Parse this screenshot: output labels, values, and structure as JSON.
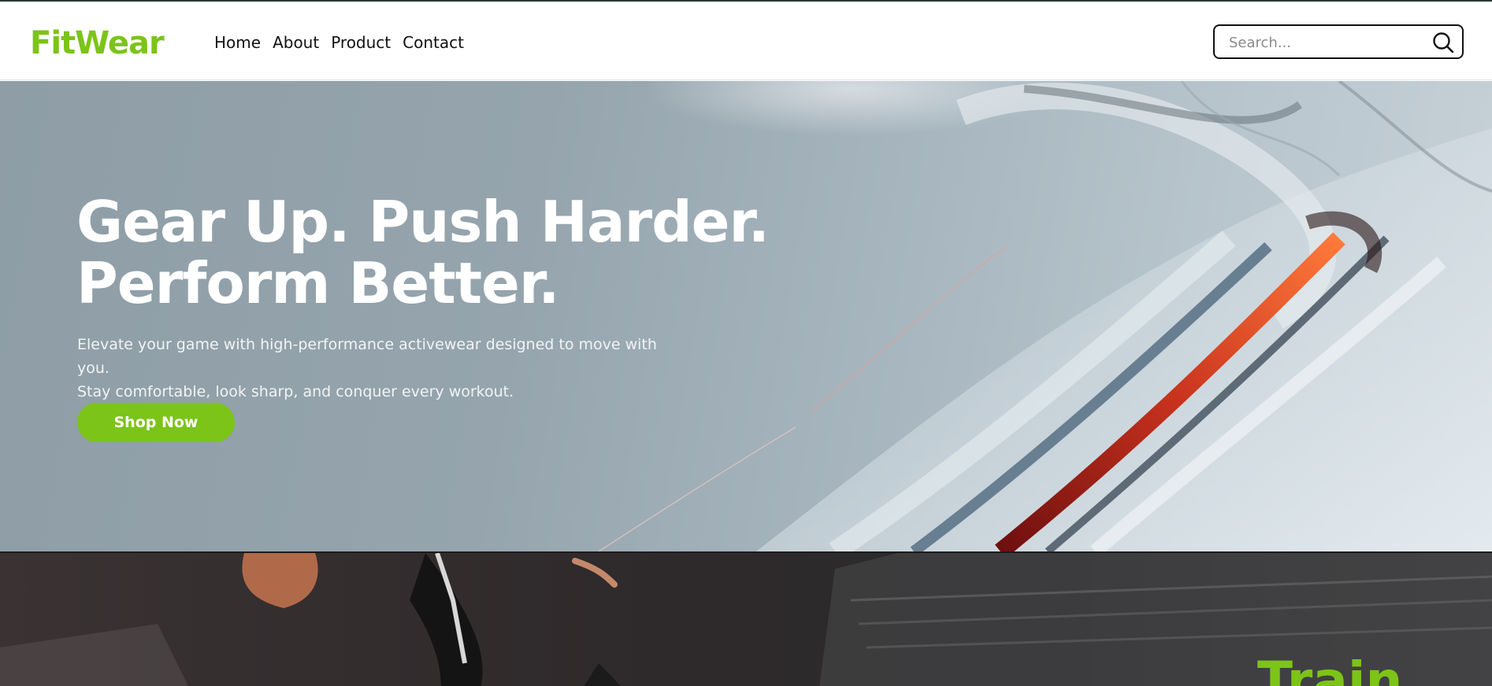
{
  "brand": {
    "name": "FitWear",
    "accent_color": "#7cc418"
  },
  "nav": {
    "links": [
      {
        "label": "Home"
      },
      {
        "label": "About"
      },
      {
        "label": "Product"
      },
      {
        "label": "Contact"
      }
    ]
  },
  "search": {
    "placeholder": "Search...",
    "icon": "search-icon"
  },
  "hero": {
    "title_line1": "Gear Up. Push Harder.",
    "title_line2": "Perform Better.",
    "subtitle_line1": "Elevate your game with high-performance activewear designed to move with you.",
    "subtitle_line2": "Stay comfortable, look sharp, and conquer every workout.",
    "cta_label": "Shop Now"
  },
  "section2": {
    "heading": "Train"
  }
}
